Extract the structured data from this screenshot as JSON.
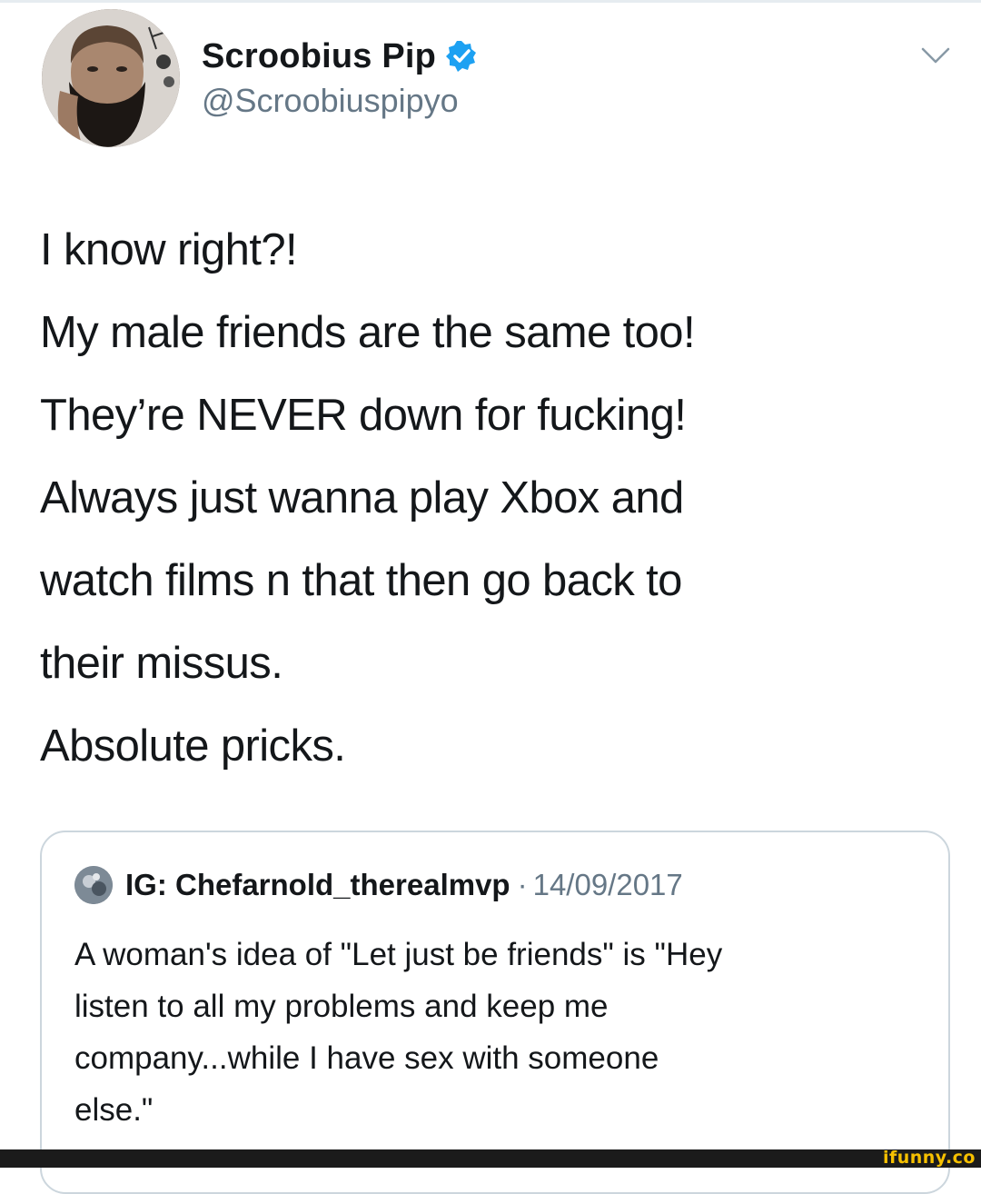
{
  "tweet": {
    "author": {
      "display_name": "Scroobius Pip",
      "handle": "@Scroobiuspipyo",
      "verified": true,
      "avatar_icon": "bearded-man-avatar"
    },
    "menu_icon": "chevron-down-icon",
    "text_lines": [
      "I know right?!",
      "My male friends are the same too!",
      "They’re NEVER down for fucking!",
      "Always just wanna play Xbox and",
      "watch films n that then go back to",
      "their missus.",
      "Absolute pricks."
    ],
    "quoted_tweet": {
      "author": "IG: Chefarnold_therealmvp",
      "separator": "·",
      "date": "14/09/2017",
      "text_lines": [
        "A woman's idea of \"Let just be friends\" is \"Hey",
        "listen to all my problems and keep me",
        "company...while I have sex with someone",
        "else.\""
      ]
    }
  },
  "watermark": {
    "text": "ifunny.co"
  },
  "colors": {
    "verified_badge": "#1da1f2",
    "secondary_text": "#657786",
    "primary_text": "#14171a",
    "card_border": "#ccd6dd",
    "watermark_bar": "#1b1b1b",
    "watermark_text": "#f6c000"
  }
}
